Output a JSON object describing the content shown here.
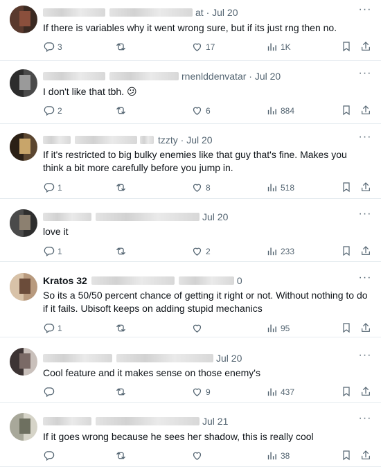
{
  "replies": [
    {
      "date": "at · Jul 20",
      "text": "If there is variables why it went wrong sure, but if its just rng then no.",
      "replies": "3",
      "likes": "17",
      "views": "1K",
      "avatar": [
        "#5a3a2e",
        "#8a4f3c",
        "#3b2a22"
      ]
    },
    {
      "date": "rnenlddenvatar · Jul 20",
      "text": "I don't like that tbh. 😕",
      "replies": "2",
      "likes": "6",
      "views": "884",
      "avatar": [
        "#2c2c2c",
        "#9a9a9a",
        "#4a4a4a"
      ]
    },
    {
      "date": "tzzty · Jul 20",
      "text": "If it's restricted to big bulky enemies like that guy that's fine. Makes you think a bit more carefully before you jump in.",
      "replies": "1",
      "likes": "8",
      "views": "518",
      "avatar": [
        "#2b2016",
        "#c8a56a",
        "#5b4630"
      ]
    },
    {
      "date": "Jul 20",
      "text": "love it",
      "replies": "1",
      "likes": "2",
      "views": "233",
      "avatar": [
        "#4a4a4a",
        "#8c8070",
        "#2e2e2e"
      ]
    },
    {
      "name": "Kratos 32",
      "date": "0",
      "text": "So its a 50/50 percent chance of getting it right or not. Without nothing to do if it fails. Ubisoft keeps on adding stupid mechanics",
      "replies": "1",
      "likes": "",
      "views": "95",
      "avatar": [
        "#d8c2a8",
        "#6b4c3a",
        "#b89a7e"
      ]
    },
    {
      "date": "Jul 20",
      "text": "Cool feature and it makes sense on those enemy's",
      "replies": "",
      "likes": "9",
      "views": "437",
      "avatar": [
        "#3d3434",
        "#7a6a66",
        "#c9c0bb"
      ]
    },
    {
      "date": "Jul 21",
      "text": "If it goes wrong because he sees her shadow, this is really cool",
      "replies": "",
      "likes": "",
      "views": "38",
      "avatar": [
        "#a8a89a",
        "#6e7060",
        "#d6d4c8"
      ]
    }
  ],
  "icons": {
    "more": "more-dots-icon",
    "reply": "reply-bubble-icon",
    "repost": "repost-icon",
    "like": "heart-icon",
    "views": "views-bar-chart-icon",
    "bookmark": "bookmark-icon",
    "share": "share-icon"
  },
  "colors": {
    "muted": "#536471",
    "text": "#0f1419",
    "divider": "#e6ecf0"
  }
}
